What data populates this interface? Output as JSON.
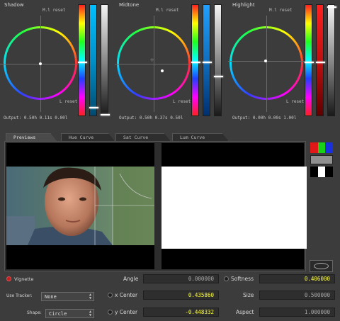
{
  "wheels": [
    {
      "title": "Shadow",
      "reset_top": "M.l reset",
      "reset_bottom": "L reset",
      "output": "Output: 0.50h 0.11s 0.00l"
    },
    {
      "title": "Midtone",
      "reset_top": "M.l reset",
      "reset_bottom": "L reset",
      "output": "Output: 0.50h 0.37s 0.50l"
    },
    {
      "title": "Highlight",
      "reset_top": "M.l reset",
      "reset_bottom": "L reset",
      "output": "Output: 0.00h 0.00s 1.00l"
    }
  ],
  "tabs": [
    "Previews",
    "Hue Curve",
    "Sat Curve",
    "Lum Curve"
  ],
  "controls": {
    "vignette_label": "Vignette",
    "use_tracker_label": "Use Tracker:",
    "use_tracker_value": "None",
    "shape_label": "Shape:",
    "shape_value": "Circle",
    "angle_label": "Angle",
    "angle_value": "0.000000",
    "x_center_label": "x Center",
    "x_center_value": "0.435860",
    "y_center_label": "y Center",
    "y_center_value": "-0.448332",
    "softness_label": "Softness",
    "softness_value": "0.406000",
    "size_label": "Size",
    "size_value": "0.500000",
    "aspect_label": "Aspect",
    "aspect_value": "1.000000"
  },
  "colors": {
    "accent_value": "#ffff40",
    "dim_value": "#a8a8a8",
    "vignette_indicator": "#d02020"
  }
}
